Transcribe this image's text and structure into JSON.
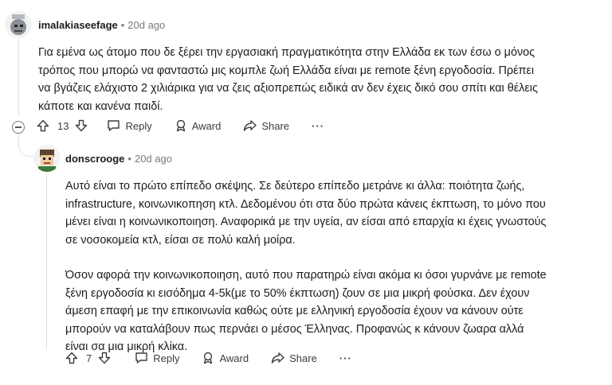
{
  "comment1": {
    "username": "imalakiaseefage",
    "time": "20d ago",
    "body": [
      "Για εμένα ως άτομο που δε ξέρει την εργασιακή πραγματικότητα στην Ελλάδα εκ των έσω ο μόνος τρόπος που μπορώ να φανταστώ μις κομπλε ζωή Ελλάδα είναι με remote ξένη εργοδοσία. Πρέπει να βγάζεις ελάχιστο 2 χιλιάρικα για να ζεις αξιοπρεπώς ειδικά αν δεν έχεις δικό σου σπίτι και θέλεις κάποτε και κανένα παιδί."
    ],
    "votes": "13",
    "reply_label": "Reply",
    "award_label": "Award",
    "share_label": "Share",
    "more_label": "···"
  },
  "comment2": {
    "username": "donscrooge",
    "time": "20d ago",
    "body": [
      "Αυτό είναι το πρώτο επίπεδο σκέψης. Σε δεύτερο επίπεδο μετράνε κι άλλα: ποιότητα ζωής, infrastructure, κοινωνικοπηση κτλ. Δεδομένου ότι στα δύο πρώτα κάνεις έκπτωση, το μόνο που μένει είναι η κοινωνικοποιηση. Αναφορικά με την υγεία, αν είσαι από επαρχία κι έχεις γνωστούς σε νοσοκομεία κτλ, είσαι σε πολύ καλή μοίρα.",
      "Όσον αφορά την κοινωνικοποιηση, αυτό που παρατηρώ είναι ακόμα κι όσοι γυρνάνε με remote ξένη εργοδοσία κι εισόδημα 4-5k(με το 50% έκπτωση) ζουν σε μια μικρή φούσκα. Δεν έχουν άμεση επαφή με την επικοινωνία καθώς ούτε με ελληνική εργοδοσία έχουν να κάνουν ούτε μπορούν να καταλάβουν πως περνάει ο μέσος Έλληνας. Προφανώς κ κάνουν ζωαρα αλλά είναι σα μια μικρή κλίκα."
    ],
    "votes": "7",
    "reply_label": "Reply",
    "award_label": "Award",
    "share_label": "Share",
    "more_label": "···"
  }
}
